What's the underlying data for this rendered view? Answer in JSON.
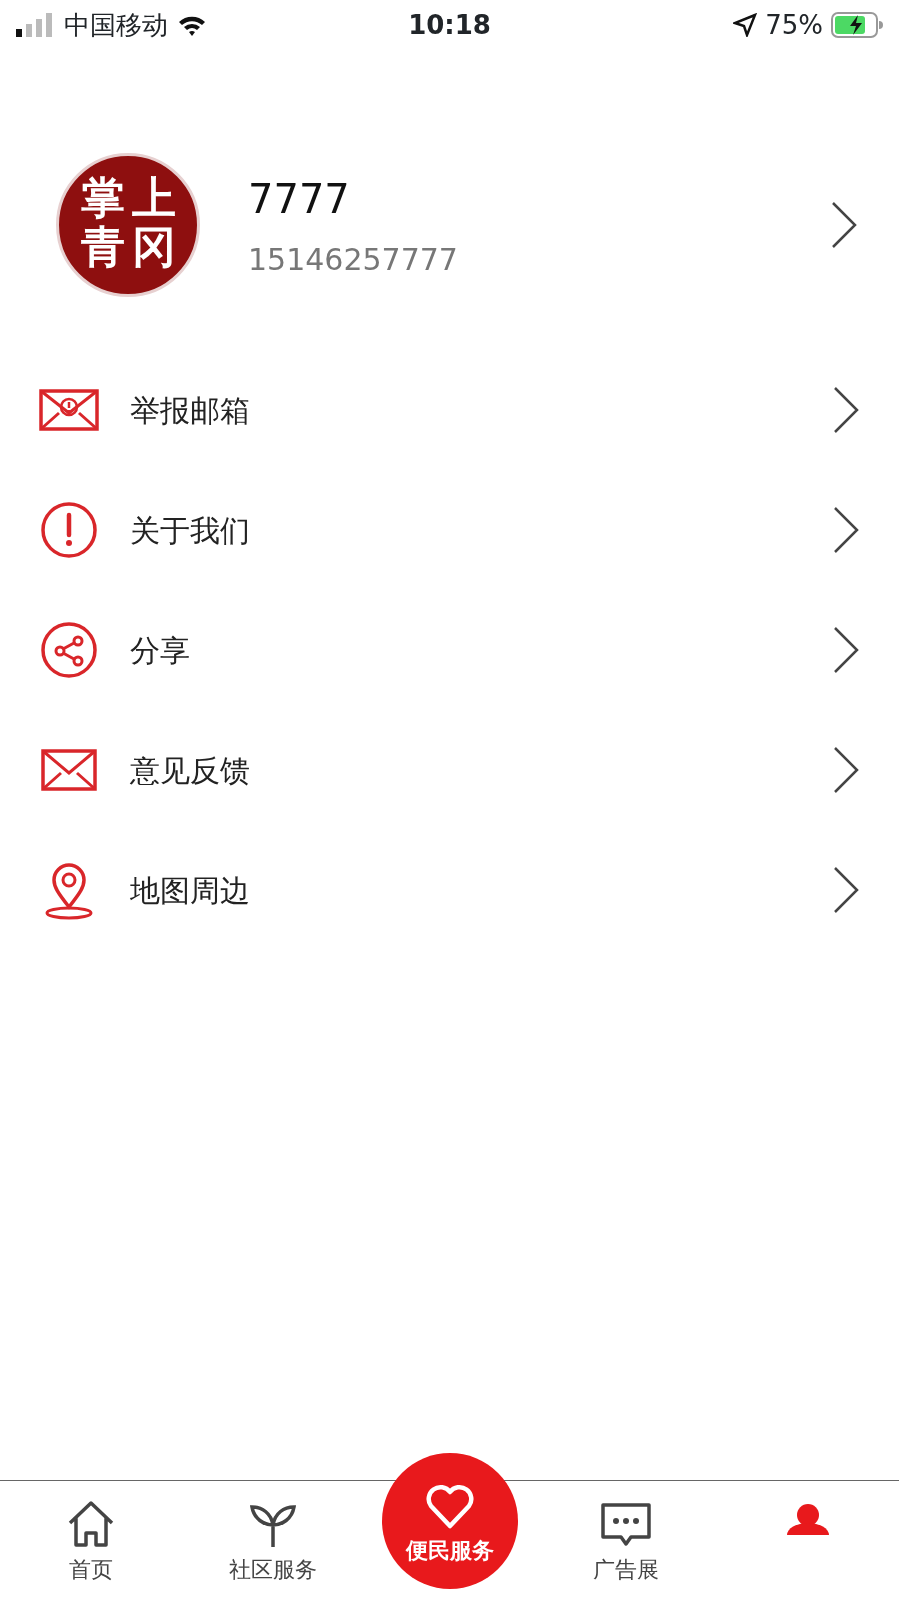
{
  "status_bar": {
    "carrier": "中国移动",
    "time": "10:18",
    "battery": "75%"
  },
  "profile": {
    "avatar_chars": [
      "掌",
      "上",
      "青",
      "冈"
    ],
    "name": "7777",
    "phone": "15146257777"
  },
  "menu": [
    {
      "label": "举报邮箱"
    },
    {
      "label": "关于我们"
    },
    {
      "label": "分享"
    },
    {
      "label": "意见反馈"
    },
    {
      "label": "地图周边"
    }
  ],
  "tab_bar": [
    {
      "kind": "tab",
      "label": "首页",
      "selected": false
    },
    {
      "kind": "tab",
      "label": "社区服务",
      "selected": false
    },
    {
      "kind": "center",
      "label": "便民服务",
      "selected": false
    },
    {
      "kind": "tab",
      "label": "广告展",
      "selected": false
    },
    {
      "kind": "tab",
      "selected": true
    }
  ]
}
